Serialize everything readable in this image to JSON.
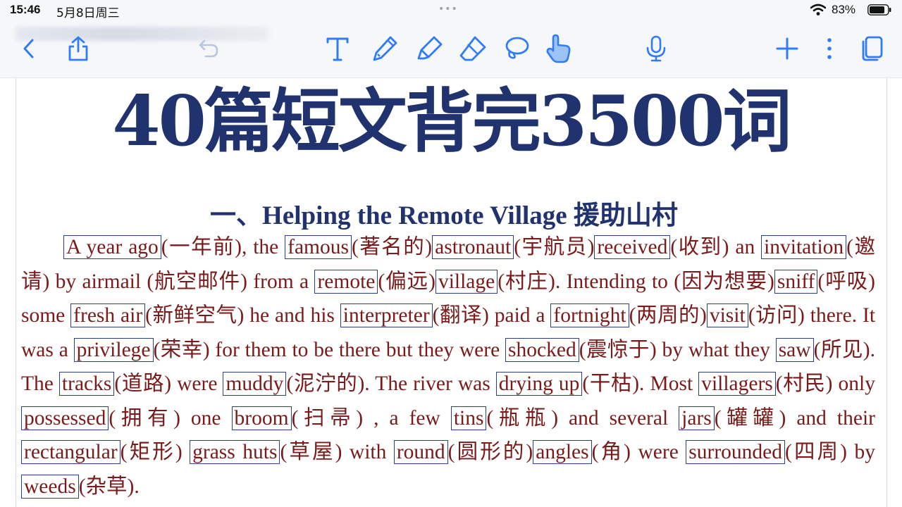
{
  "status_bar": {
    "time": "15:46",
    "date": "5月8日周三",
    "dots": "•••",
    "battery_percent": "83%"
  },
  "toolbar": {
    "icons": [
      "back-chevron-icon",
      "share-icon",
      "undo-icon",
      "text-tool-icon",
      "pen-icon",
      "highlighter-icon",
      "eraser-icon",
      "lasso-icon",
      "hand-pointer-icon",
      "microphone-icon",
      "add-icon",
      "more-icon",
      "pages-icon"
    ]
  },
  "colors": {
    "title": "#20336e",
    "body": "#7a1a1a",
    "box": "#2a3d8a",
    "accent": "#2f7cf6"
  },
  "document": {
    "title": "40篇短文背完3500词",
    "subtitle": "一、Helping the Remote Village 援助山村",
    "body": [
      {
        "k": "A year ago"
      },
      {
        "t": "(一年前), the "
      },
      {
        "k": "famous"
      },
      {
        "t": "(著名的)"
      },
      {
        "k": "astronaut"
      },
      {
        "t": "(宇航员)"
      },
      {
        "k": "received"
      },
      {
        "t": "(收到) an "
      },
      {
        "k": "invitation"
      },
      {
        "t": "(邀请) by airmail (航空邮件) from a "
      },
      {
        "k": "remote"
      },
      {
        "t": "(偏远)"
      },
      {
        "k": "village"
      },
      {
        "t": "(村庄). Intending to (因为想要)"
      },
      {
        "k": "sniff"
      },
      {
        "t": "(呼吸) some "
      },
      {
        "k": "fresh air"
      },
      {
        "t": "(新鲜空气) he and his "
      },
      {
        "k": "interpreter"
      },
      {
        "t": "(翻译) paid a "
      },
      {
        "k": "fortnight"
      },
      {
        "t": "(两周的)"
      },
      {
        "k": "visit"
      },
      {
        "t": "(访问) there. It was a "
      },
      {
        "k": "privilege"
      },
      {
        "t": "(荣幸) for them to be there but they were "
      },
      {
        "k": "shocked"
      },
      {
        "t": "(震惊于) by what they "
      },
      {
        "k": "saw"
      },
      {
        "t": "(所见). The "
      },
      {
        "k": "tracks"
      },
      {
        "t": "(道路) were "
      },
      {
        "k": "muddy"
      },
      {
        "t": "(泥泞的). The river was "
      },
      {
        "k": "drying up"
      },
      {
        "t": "(干枯). Most "
      },
      {
        "k": "villagers"
      },
      {
        "t": "(村民) only "
      },
      {
        "k": "possessed"
      },
      {
        "t": "(拥有) one "
      },
      {
        "k": "broom"
      },
      {
        "t": "(扫帚) , a few "
      },
      {
        "k": "tins"
      },
      {
        "t": "(瓶瓶) and several "
      },
      {
        "k": "jars"
      },
      {
        "t": "(罐罐) and their "
      },
      {
        "k": "rectangular"
      },
      {
        "t": "(矩形) "
      },
      {
        "k": "grass huts"
      },
      {
        "t": "(草屋) with "
      },
      {
        "k": "round"
      },
      {
        "t": "(圆形的)"
      },
      {
        "k": "angles"
      },
      {
        "t": "(角) were "
      },
      {
        "k": "surrounded"
      },
      {
        "t": "(四周) by "
      },
      {
        "k": "weeds"
      },
      {
        "t": "(杂草)."
      }
    ]
  }
}
